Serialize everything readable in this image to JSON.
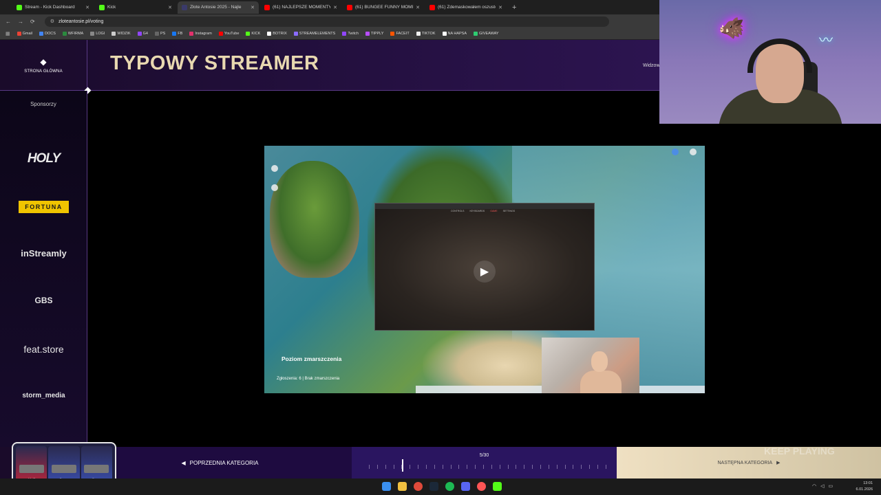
{
  "browser": {
    "tabs": [
      {
        "label": "Stream - Kick Dashboard",
        "color": "#53fc18",
        "active": false
      },
      {
        "label": "Kick",
        "color": "#53fc18",
        "active": false
      },
      {
        "label": "Złote Antosie 2025 - Najle",
        "color": "#3a3a6a",
        "active": true
      },
      {
        "label": "(61) NAJLEPSZE MOMENTY PO",
        "color": "#ff0000",
        "active": false
      },
      {
        "label": "(61) BUNGEE FUNNY MOMENT",
        "color": "#ff0000",
        "active": false
      },
      {
        "label": "(61) Zdemaskowałem oszustó",
        "color": "#ff0000",
        "active": false
      }
    ],
    "url": "zloteantosie.pl/voting",
    "bookmarks": [
      {
        "label": "Gmail",
        "color": "#ea4335"
      },
      {
        "label": "DOCS",
        "color": "#4285f4"
      },
      {
        "label": "WFIRMA",
        "color": "#2b8a3e"
      },
      {
        "label": "LOGI",
        "color": "#888888"
      },
      {
        "label": "WIDZIK",
        "color": "#cccccc"
      },
      {
        "label": "G4",
        "color": "#9146ff"
      },
      {
        "label": "PS",
        "color": "#666666"
      },
      {
        "label": "FB",
        "color": "#1877f2"
      },
      {
        "label": "Instagram",
        "color": "#e1306c"
      },
      {
        "label": "YouTube",
        "color": "#ff0000"
      },
      {
        "label": "KICK",
        "color": "#53fc18"
      },
      {
        "label": "BOTRIX",
        "color": "#ffffff"
      },
      {
        "label": "STREAMELEMENTS",
        "color": "#8a6cff"
      },
      {
        "label": "Twitch",
        "color": "#9146ff"
      },
      {
        "label": "TIPPLY",
        "color": "#b84dff"
      },
      {
        "label": "FACEIT",
        "color": "#ff5500"
      },
      {
        "label": "TIKTOK",
        "color": "#eeeeee"
      },
      {
        "label": "NA HAPSA",
        "color": "#ffffff"
      },
      {
        "label": "GIVEAWAY",
        "color": "#2ecc71"
      }
    ]
  },
  "page": {
    "home_label": "STRONA GŁÓWNA",
    "title": "TYPOWY STREAMER",
    "header_right": "Widzow",
    "sponsors_label": "Sponsorzy",
    "sponsors": [
      "HOLY",
      "FORTUNA",
      "inStreamly",
      "GBS",
      "feat.store",
      "storm_media"
    ]
  },
  "video": {
    "overlay_title": "Poziom zmarszczenia",
    "overlay_sub": "Zgłoszenia: 6 | Brak zmarszczenia",
    "app_tabs": [
      "CONTROLS",
      "KEYBOARDS",
      "GAME",
      "SETTINGS"
    ]
  },
  "navigation": {
    "prev_label": "POPRZEDNIA KATEGORIA",
    "next_label": "NASTĘPNA KATEGORIA",
    "progress_text": "5/30",
    "current": 5,
    "total": 30
  },
  "overlay": {
    "keep_playing": "KEEP PLAYING",
    "weapons": [
      {
        "name": "AK-47",
        "rarity": "Exceptional",
        "color": "#c0263a"
      },
      {
        "name": "Famas",
        "rarity": "Exceptional",
        "color": "#3a4fb0"
      },
      {
        "name": "Famas",
        "rarity": "Exceptional",
        "color": "#3a4fb0"
      }
    ]
  },
  "taskbar": {
    "time": "13:01",
    "date": "6.01.2026"
  }
}
